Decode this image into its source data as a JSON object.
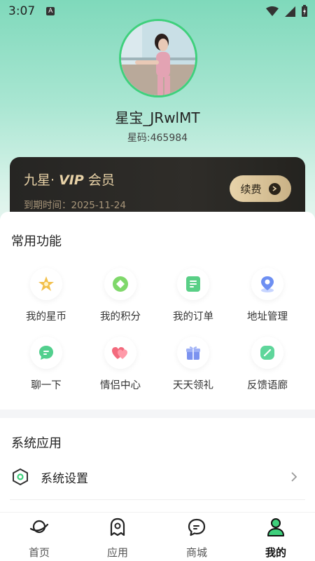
{
  "status": {
    "time": "3:07",
    "a_badge": "A"
  },
  "profile": {
    "username": "星宝_JRwlMT",
    "star_code": "星码:465984"
  },
  "vip": {
    "title_prefix": "九星· ",
    "title_vip": "VIP",
    "title_suffix": " 会员",
    "expire": "到期时间：2025-11-24",
    "renew_label": "续费"
  },
  "common": {
    "title": "常用功能",
    "items": [
      {
        "label": "我的星币",
        "icon": "star-coin-icon"
      },
      {
        "label": "我的积分",
        "icon": "points-icon"
      },
      {
        "label": "我的订单",
        "icon": "order-icon"
      },
      {
        "label": "地址管理",
        "icon": "location-icon"
      },
      {
        "label": "聊一下",
        "icon": "chat-icon"
      },
      {
        "label": "情侣中心",
        "icon": "hearts-icon"
      },
      {
        "label": "天天领礼",
        "icon": "gift-icon"
      },
      {
        "label": "反馈语廊",
        "icon": "feedback-icon"
      }
    ]
  },
  "system": {
    "title": "系统应用",
    "settings_label": "系统设置"
  },
  "nav": {
    "items": [
      {
        "label": "首页",
        "icon": "planet-icon",
        "active": false
      },
      {
        "label": "应用",
        "icon": "ghost-icon",
        "active": false
      },
      {
        "label": "商城",
        "icon": "chat-bubble-icon",
        "active": false
      },
      {
        "label": "我的",
        "icon": "user-icon",
        "active": true
      }
    ]
  },
  "colors": {
    "accent": "#3fd07c",
    "vip_gold": "#e8d2a7",
    "vip_dark": "#262523"
  }
}
